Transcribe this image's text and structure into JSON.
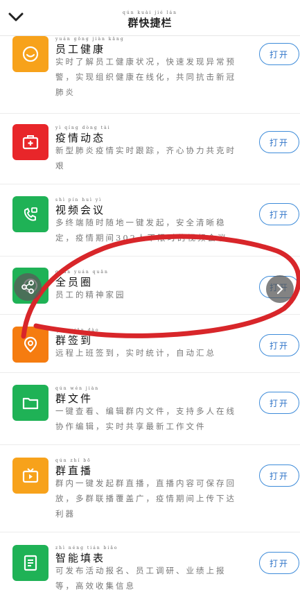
{
  "header": {
    "title": "群快捷栏",
    "title_pinyin": "qún kuài jié lán",
    "back_icon": "chevron-down-icon"
  },
  "items": [
    {
      "name": "员工健康",
      "name_pinyin": "yuán gōng jiàn kāng",
      "desc": "实时了解员工健康状况，快速发现异常预警，实现组织健康在线化，共同抗击新冠肺炎",
      "button": "打开",
      "icon": "smile-heart-icon",
      "color": "#f7a21b"
    },
    {
      "name": "疫情动态",
      "name_pinyin": "yì qíng dòng tài",
      "desc": "新型肺炎疫情实时跟踪，齐心协力共克时艰",
      "button": "打开",
      "icon": "medical-kit-icon",
      "color": "#e8262a"
    },
    {
      "name": "视频会议",
      "name_pinyin": "shì pín huì yì",
      "desc": "多终端随时随地一键发起，安全清晰稳定，疫情期间302人不限时的视频会议",
      "button": "打开",
      "icon": "video-call-icon",
      "color": "#1fb256"
    },
    {
      "name": "全员圈",
      "name_pinyin": "quán yuán quān",
      "desc": "员工的精神家园",
      "button": "打开",
      "icon": "circle-icon",
      "color": "#1fb256"
    },
    {
      "name": "群签到",
      "name_pinyin": "qún qiān dào",
      "desc": "远程上班签到，实时统计，自动汇总",
      "button": "打开",
      "icon": "location-pin-icon",
      "color": "#f57c10"
    },
    {
      "name": "群文件",
      "name_pinyin": "qún wén jiàn",
      "desc": "一键查看、编辑群内文件，支持多人在线协作编辑，实时共享最新工作文件",
      "button": "打开",
      "icon": "folder-icon",
      "color": "#1fb256"
    },
    {
      "name": "群直播",
      "name_pinyin": "qún zhí bō",
      "desc": "群内一键发起群直播，直播内容可保存回放，多群联播覆盖广，疫情期间上传下达利器",
      "button": "打开",
      "icon": "tv-play-icon",
      "color": "#f7a21b"
    },
    {
      "name": "智能填表",
      "name_pinyin": "zhì néng tián biǎo",
      "desc": "可发布活动报名、员工调研、业绩上报等，高效收集信息",
      "button": "打开",
      "icon": "form-icon",
      "color": "#1fb256"
    }
  ],
  "overlay": {
    "scribble_color": "#d8262a",
    "left_nav_icon": "share-nodes-icon",
    "right_nav_icon": "chevron-right-icon"
  }
}
